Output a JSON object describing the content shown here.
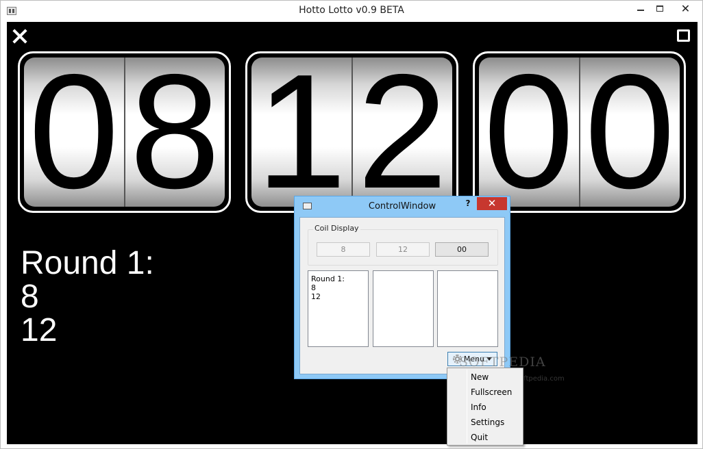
{
  "window": {
    "title": "Hotto Lotto v0.9 BETA"
  },
  "coils": [
    {
      "digits": [
        "0",
        "8"
      ]
    },
    {
      "digits": [
        "1",
        "2"
      ]
    },
    {
      "digits": [
        "0",
        "0"
      ]
    }
  ],
  "rounds": {
    "label": "Round 1:",
    "numbers": [
      "8",
      "12"
    ]
  },
  "control_window": {
    "title": "ControlWindow",
    "help_label": "?",
    "close_label": "✕",
    "group_label": "Coil Display",
    "coil_buttons": [
      "8",
      "12",
      "00"
    ],
    "lists": [
      {
        "lines": [
          "Round 1:",
          "8",
          "12"
        ]
      },
      {
        "lines": []
      },
      {
        "lines": []
      }
    ],
    "menu_button": {
      "label": "Menu",
      "icon": "gear-icon"
    }
  },
  "menu": {
    "items": [
      "New",
      "Fullscreen",
      "Info",
      "Settings",
      "Quit"
    ]
  },
  "watermark": {
    "text": "SOFTPEDIA",
    "url": "www.softpedia.com"
  },
  "colors": {
    "stage_bg": "#000000",
    "control_frame": "#8ec9f6",
    "close_red": "#c7372f"
  }
}
